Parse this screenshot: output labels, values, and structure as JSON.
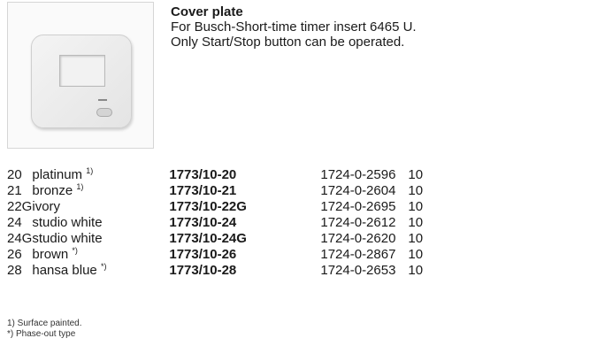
{
  "product": {
    "title": "Cover plate",
    "description_lines": [
      "For Busch-Short-time timer insert 6465 U.",
      "Only Start/Stop button can be operated."
    ]
  },
  "variants": [
    {
      "code": "20",
      "color": "platinum",
      "note": "1)",
      "order_no": "1773/10-20",
      "ean": "1724-0-2596",
      "pack": "10"
    },
    {
      "code": "21",
      "color": "bronze",
      "note": "1)",
      "order_no": "1773/10-21",
      "ean": "1724-0-2604",
      "pack": "10"
    },
    {
      "code": "22G",
      "color": "ivory",
      "note": "",
      "order_no": "1773/10-22G",
      "ean": "1724-0-2695",
      "pack": "10"
    },
    {
      "code": "24",
      "color": "studio white",
      "note": "",
      "order_no": "1773/10-24",
      "ean": "1724-0-2612",
      "pack": "10"
    },
    {
      "code": "24G",
      "color": "studio white",
      "note": "",
      "order_no": "1773/10-24G",
      "ean": "1724-0-2620",
      "pack": "10"
    },
    {
      "code": "26",
      "color": "brown",
      "note": "*)",
      "order_no": "1773/10-26",
      "ean": "1724-0-2867",
      "pack": "10"
    },
    {
      "code": "28",
      "color": "hansa blue",
      "note": "*)",
      "order_no": "1773/10-28",
      "ean": "1724-0-2653",
      "pack": "10"
    }
  ],
  "footnotes": [
    "1)  Surface painted.",
    "*)  Phase-out type"
  ]
}
